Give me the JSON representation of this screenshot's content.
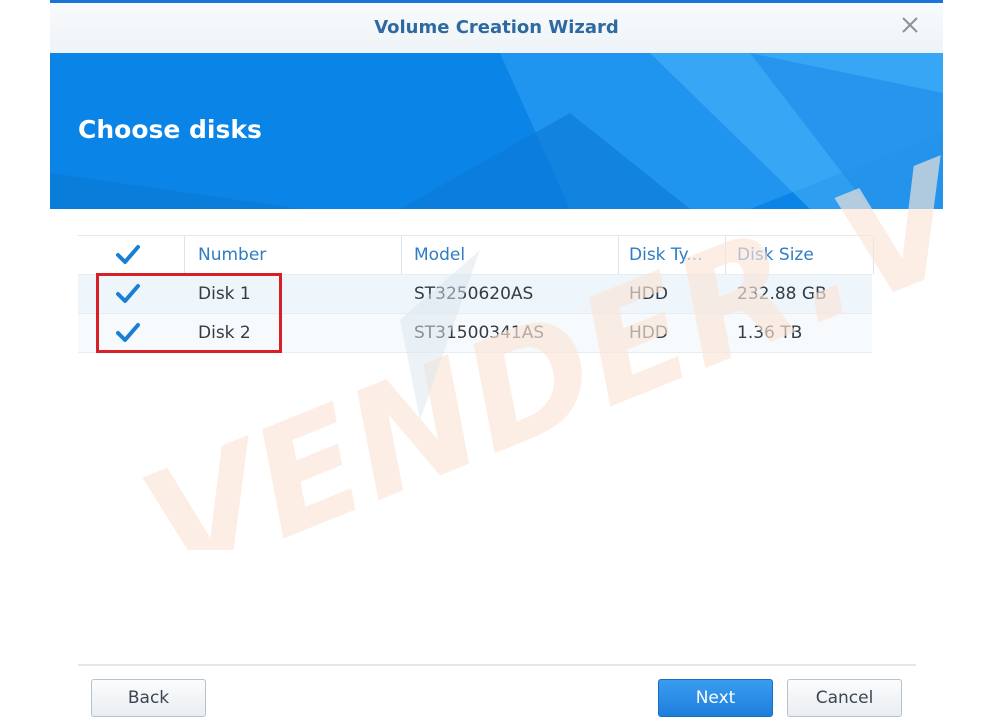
{
  "window": {
    "title": "Volume Creation Wizard",
    "close_icon": "close-icon"
  },
  "banner": {
    "title": "Choose disks"
  },
  "table": {
    "select_all_checked": true,
    "columns": [
      "Number",
      "Model",
      "Disk Ty...",
      "Disk Size"
    ],
    "rows": [
      {
        "checked": true,
        "number": "Disk 1",
        "model": "ST3250620AS",
        "type": "HDD",
        "size": "232.88 GB"
      },
      {
        "checked": true,
        "number": "Disk 2",
        "model": "ST31500341AS",
        "type": "HDD",
        "size": "1.36 TB"
      }
    ]
  },
  "footer": {
    "back_label": "Back",
    "next_label": "Next",
    "cancel_label": "Cancel"
  },
  "watermark": {
    "text": "VENDER.VN"
  },
  "colors": {
    "accent": "#0a84e6",
    "title": "#2e6a9f",
    "header_text": "#2f7cc4",
    "highlight": "#d81f26",
    "watermark": "#fbe3d3"
  }
}
